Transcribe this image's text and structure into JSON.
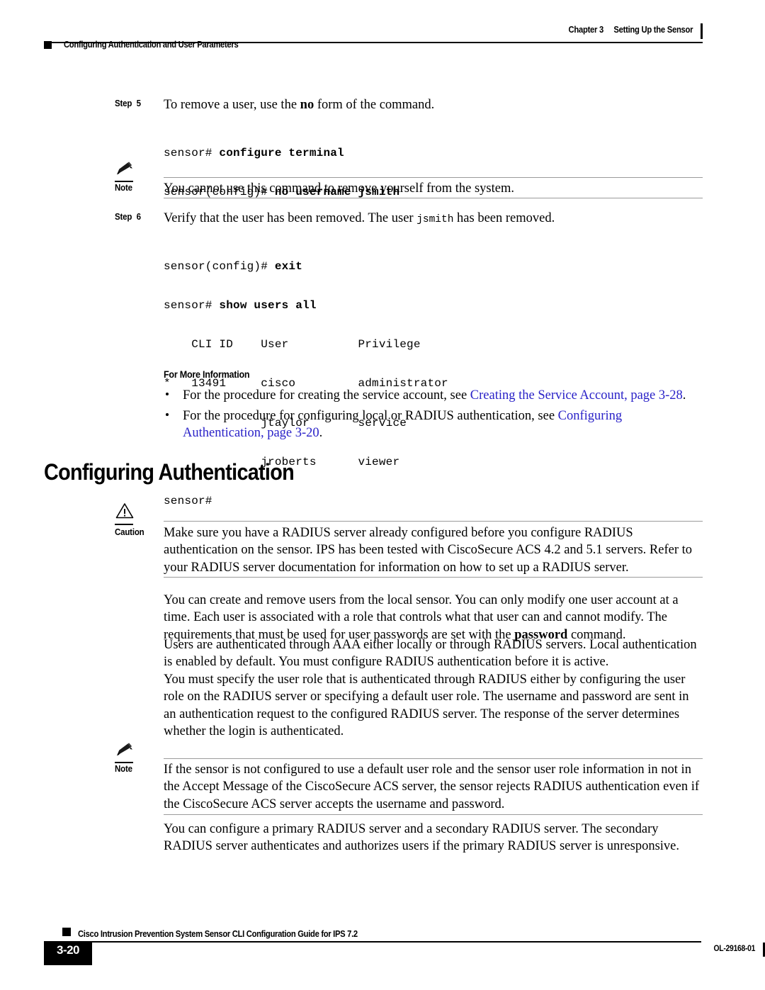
{
  "header": {
    "chapter": "Chapter 3",
    "chapter_title": "Setting Up the Sensor",
    "running_head": "Configuring Authentication and User Parameters"
  },
  "steps": [
    {
      "label": "Step",
      "number": "5",
      "text_before": "To remove a user, use the ",
      "bold_term": "no",
      "text_after": " form of the command."
    },
    {
      "label": "Step",
      "number": "6",
      "text_before": "Verify that the user has been removed. The user ",
      "mono_term": "jsmith",
      "text_after": " has been removed."
    }
  ],
  "code_block_1": [
    {
      "prompt": "sensor# ",
      "command": "configure terminal"
    },
    {
      "prompt": "sensor(config)# ",
      "command": "no username jsmith"
    }
  ],
  "code_block_2": {
    "line1_prompt": "sensor(config)# ",
    "line1_command": "exit",
    "line2_prompt": "sensor# ",
    "line2_command": "show users all",
    "table_header": "    CLI ID    User          Privilege",
    "rows": [
      "*   13491     cisco         administrator",
      "              jtaylor       service",
      "              jroberts      viewer"
    ],
    "final_prompt": "sensor#"
  },
  "note_1": {
    "keyword": "Note",
    "icon": "pencil-icon",
    "text": "You cannot use this command to remove yourself from the system."
  },
  "for_more_information": {
    "heading": "For More Information",
    "bullets": [
      {
        "text_before": "For the procedure for creating the service account, see ",
        "link": "Creating the Service Account, page 3-28",
        "text_after": "."
      },
      {
        "text_before": "For the procedure for configuring local or RADIUS authentication, see ",
        "link": "Configuring Authentication, page 3-20",
        "text_after": "."
      }
    ]
  },
  "section_heading": "Configuring Authentication",
  "caution": {
    "keyword": "Caution",
    "icon": "warning-triangle-icon",
    "text": "Make sure you have a RADIUS server already configured before you configure RADIUS authentication on the sensor. IPS has been tested with CiscoSecure ACS 4.2 and 5.1 servers. Refer to your RADIUS server documentation for information on how to set up a RADIUS server."
  },
  "paragraphs": {
    "p1_before": "You can create and remove users from the local sensor. You can only modify one user account at a time. Each user is associated with a role that controls what that user can and cannot modify. The requirements that must be used for user passwords are set with the ",
    "p1_bold": "password",
    "p1_after": " command.",
    "p2": "Users are authenticated through AAA either locally or through RADIUS servers. Local authentication is enabled by default. You must configure RADIUS authentication before it is active.",
    "p3": "You must specify the user role that is authenticated through RADIUS either by configuring the user role on the RADIUS server or specifying a default user role. The username and password are sent in an authentication request to the configured RADIUS server. The response of the server determines whether the login is authenticated.",
    "p4": "You can configure a primary RADIUS server and a secondary RADIUS server. The secondary RADIUS server authenticates and authorizes users if the primary RADIUS server is unresponsive."
  },
  "note_2": {
    "keyword": "Note",
    "icon": "pencil-icon",
    "text": "If the sensor is not configured to use a default user role and the sensor user role information in not in the Accept Message of the CiscoSecure ACS server, the sensor rejects RADIUS authentication even if the CiscoSecure ACS server accepts the username and password."
  },
  "footer": {
    "guide_title": "Cisco Intrusion Prevention System Sensor CLI Configuration Guide for IPS 7.2",
    "page_number": "3-20",
    "doc_id": "OL-29168-01"
  },
  "colors": {
    "link": "#2a22c8",
    "rule": "#9b9b9b",
    "text": "#000000"
  }
}
